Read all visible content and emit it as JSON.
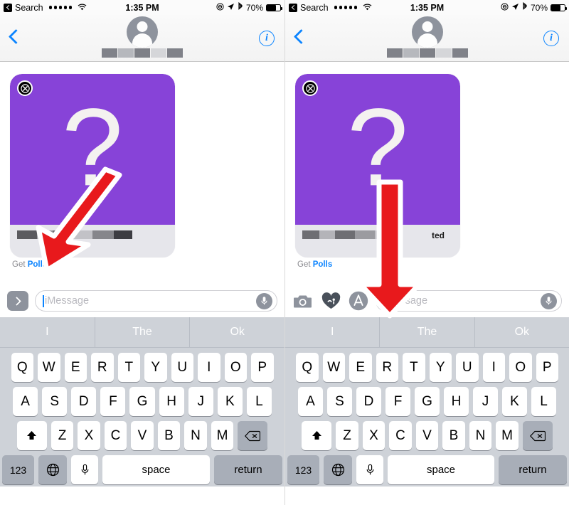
{
  "meta": {
    "accent_blue": "#0b84ff",
    "bubble_purple": "#8743d8",
    "keyboard_bg": "#ced2d8",
    "arrow_red": "#e8191c"
  },
  "status_bar": {
    "back_label": "Search",
    "signal_dots": 5,
    "wifi_icon": "wifi-icon",
    "time": "1:35 PM",
    "alarm_icon": "alarm-icon",
    "location_icon": "location-arrow-icon",
    "bluetooth_icon": "bluetooth-icon",
    "battery_percent": "70%",
    "battery_icon": "battery-icon"
  },
  "nav_bar": {
    "back_icon": "chevron-left-icon",
    "avatar_icon": "contact-avatar-icon",
    "contact_name_redacted": true,
    "info_label": "i"
  },
  "conversation": {
    "bubble": {
      "close_icon": "close-x-icon",
      "artwork_glyph": "?",
      "footer_redacted": true,
      "delivered_fragment": "ted"
    },
    "caption": {
      "prefix": "Get ",
      "app_name": "Polls"
    }
  },
  "toolbar_left": {
    "expand_icon": "chevron-right-expand-icon",
    "input_placeholder": "iMessage",
    "input_value": "",
    "mic_icon": "microphone-icon"
  },
  "toolbar_right": {
    "camera_icon": "camera-icon",
    "digital_touch_icon": "digital-touch-heart-icon",
    "app_store_icon": "imessage-app-store-icon",
    "input_placeholder": "iMessage",
    "input_value": "",
    "mic_icon": "microphone-icon"
  },
  "keyboard": {
    "predictions": [
      "I",
      "The",
      "Ok"
    ],
    "row1": [
      "Q",
      "W",
      "E",
      "R",
      "T",
      "Y",
      "U",
      "I",
      "O",
      "P"
    ],
    "row2": [
      "A",
      "S",
      "D",
      "F",
      "G",
      "H",
      "J",
      "K",
      "L"
    ],
    "row3": [
      "Z",
      "X",
      "C",
      "V",
      "B",
      "N",
      "M"
    ],
    "shift_icon": "shift-arrow-icon",
    "delete_icon": "backspace-delete-icon",
    "numbers_label": "123",
    "globe_icon": "globe-language-icon",
    "dictation_icon": "microphone-dictation-icon",
    "space_label": "space",
    "return_label": "return"
  },
  "annotations": {
    "left_arrow": "diagonal-arrow-pointing-to-get-polls",
    "right_arrow": "down-arrow-pointing-to-app-store-button"
  }
}
